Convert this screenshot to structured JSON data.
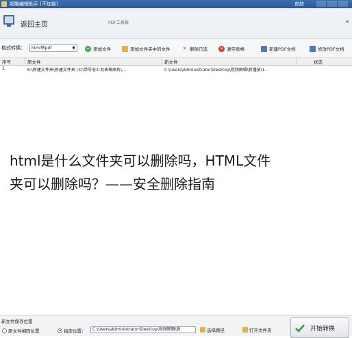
{
  "window": {
    "title": "超酷编辑助手 [不加锁]",
    "right_text": "皮肤"
  },
  "header": {
    "home_label": "返回主页",
    "tool_label": "PDF工具箱",
    "collapse_glyph": "«"
  },
  "toolbar": {
    "format_label": "格式转换：",
    "format_value": "html转pdf",
    "buttons": [
      {
        "label": "添加文件",
        "icon": "plus-icon",
        "color": "#3aa757"
      },
      {
        "label": "添加文件夹中的文件",
        "icon": "folder-icon",
        "color": "#e2b24a"
      },
      {
        "label": "删除已选",
        "icon": "x-icon",
        "color": "#d23a2a"
      },
      {
        "label": "清空表格",
        "icon": "clear-icon",
        "color": "#d23a2a"
      },
      {
        "label": "新建PDF文档",
        "icon": "new-doc-icon",
        "color": "#4a7bbf"
      },
      {
        "label": "修改PDF文档",
        "icon": "edit-doc-icon",
        "color": "#4a7bbf"
      }
    ]
  },
  "table": {
    "columns": [
      "序号",
      "原文件",
      "新文件",
      "状态"
    ],
    "rows": [
      {
        "index": "1",
        "source": "E:\\新建文件夹\\新建文件夹 (3)\\单号总汇及表格图片\\...",
        "target": "C:\\Users\\Administrator\\Desktop\\视频图辑\\新播放\\1...",
        "status": ""
      }
    ]
  },
  "overlay": {
    "line1": "html是什么文件夹可以删除吗，HTML文件",
    "line2": "夹可以删除吗？——安全删除指南"
  },
  "bottom": {
    "save_title": "新文件保存位置",
    "option_same": "原文件相同位置",
    "option_custom": "指定位置：",
    "path_value": "C:\\Users\\Administrator\\Desktop\\视频图辑\\新",
    "choose_label": "选择路径",
    "open_label": "打开文件夹",
    "start_label": "开始转换"
  }
}
